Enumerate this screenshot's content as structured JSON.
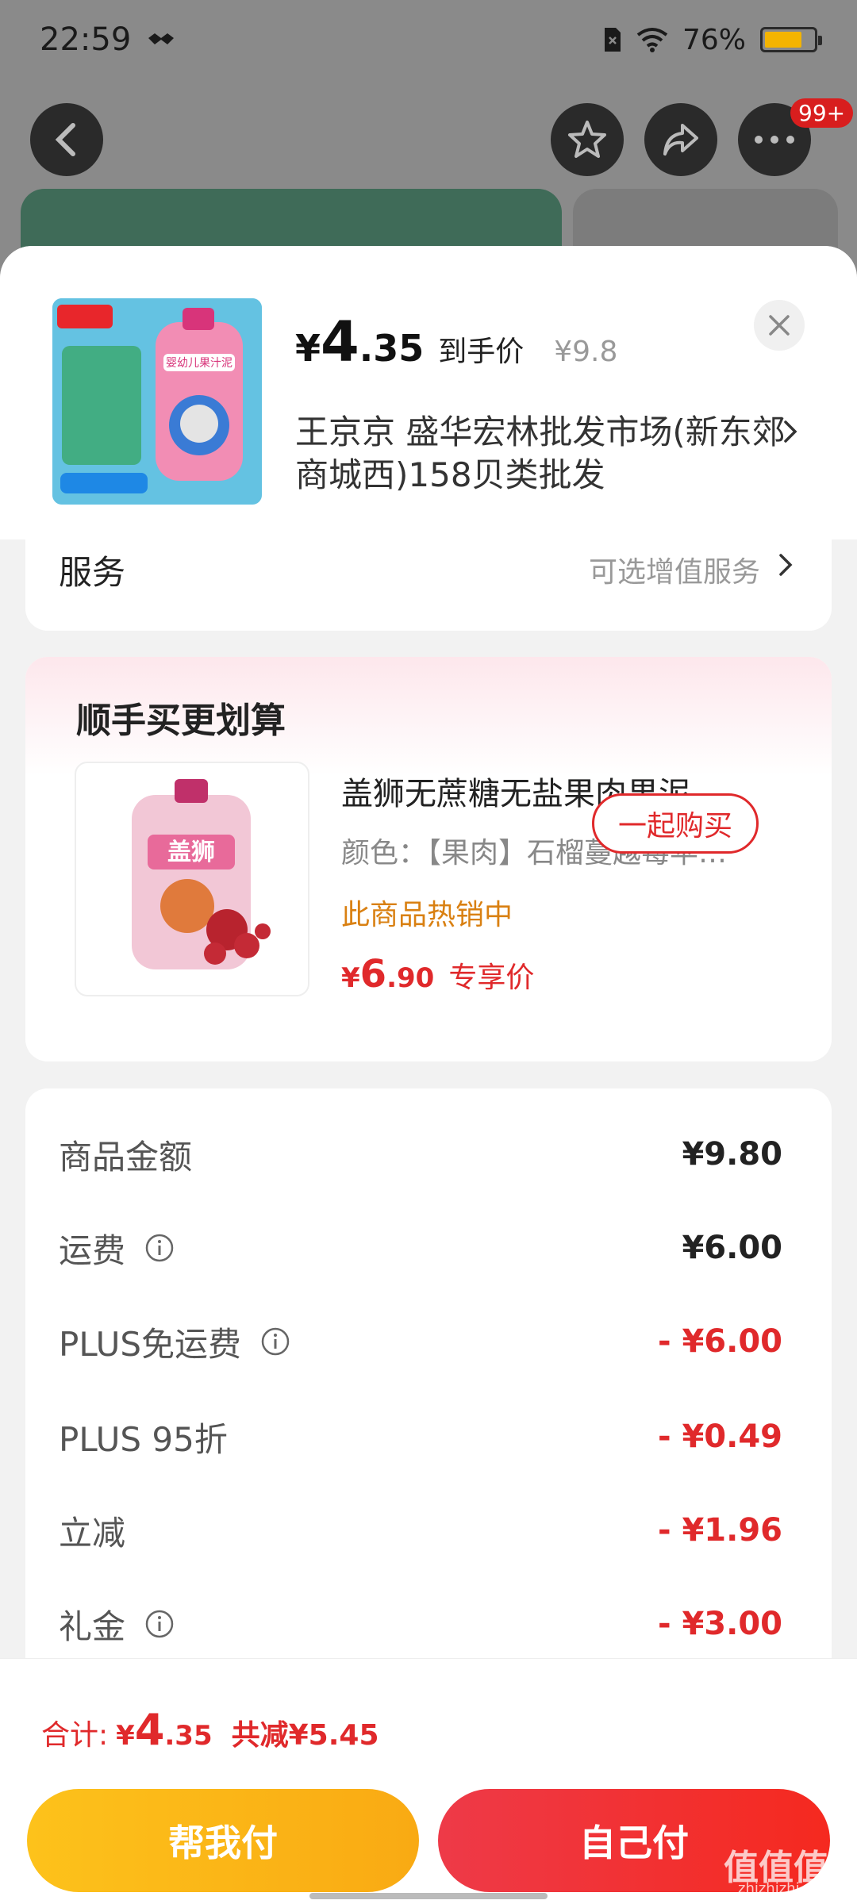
{
  "status_bar": {
    "time": "22:59",
    "battery": "76%",
    "battery_level": 0.76
  },
  "nav": {
    "badge": "99+"
  },
  "product": {
    "price_yen": "¥",
    "price_int": "4",
    "price_dec": ".35",
    "price_tag": "到手价",
    "price_original": "¥9.8",
    "shop_name": "王京京  盛华宏林批发市场(新东郊商城西)158贝类批发",
    "thumb_text": "婴幼儿果汁泥"
  },
  "service": {
    "title": "服务",
    "hint": "可选增值服务"
  },
  "addon": {
    "title": "顺手买更划算",
    "name": "盖狮无蔗糖无盐果肉果泥…",
    "spec": "颜色：【果肉】石榴蔓越莓苹…",
    "hot": "此商品热销中",
    "price_yen": "¥",
    "price_int": "6",
    "price_dec": ".90",
    "price_tag": "专享价",
    "button": "一起购买",
    "img_text": "盖狮"
  },
  "summary": [
    {
      "label": "商品金额",
      "value": "¥9.80",
      "info": false,
      "negative": false
    },
    {
      "label": "运费",
      "value": "¥6.00",
      "info": true,
      "negative": false
    },
    {
      "label": "PLUS免运费",
      "value": "- ¥6.00",
      "info": true,
      "negative": true
    },
    {
      "label": "PLUS 95折",
      "value": "- ¥0.49",
      "info": false,
      "negative": true
    },
    {
      "label": "立减",
      "value": "- ¥1.96",
      "info": false,
      "negative": true
    },
    {
      "label": "礼金",
      "value": "- ¥3.00",
      "info": true,
      "negative": true
    }
  ],
  "bottom": {
    "total_label": "合计:",
    "total_yen": "¥",
    "total_int": "4",
    "total_dec": ".35",
    "total_save": "共减¥5.45",
    "help_pay": "帮我付",
    "self_pay": "自己付"
  },
  "watermark": {
    "main": "值值值",
    "sub": "zhizhizhi.com"
  },
  "colors": {
    "accent_red": "#e0292b",
    "gold": "#fdc21b",
    "orange_text": "#d98012"
  }
}
